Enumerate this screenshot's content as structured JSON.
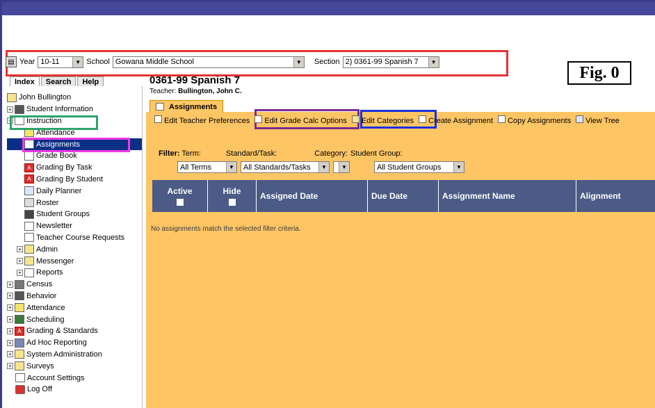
{
  "toolbar": {
    "year_label": "Year",
    "year_value": "10-11",
    "school_label": "School",
    "school_value": "Gowana Middle School",
    "section_label": "Section",
    "section_value": "2) 0361-99 Spanish 7"
  },
  "fig_label": "Fig. 0",
  "tabs": [
    "Index",
    "Search",
    "Help"
  ],
  "sidebar": {
    "items": [
      {
        "label": "John Bullington"
      },
      {
        "label": "Student Information"
      },
      {
        "label": "Instruction"
      },
      {
        "label": "Attendance"
      },
      {
        "label": "Assignments"
      },
      {
        "label": "Grade Book"
      },
      {
        "label": "Grading By Task"
      },
      {
        "label": "Grading By Student"
      },
      {
        "label": "Daily Planner"
      },
      {
        "label": "Roster"
      },
      {
        "label": "Student Groups"
      },
      {
        "label": "Newsletter"
      },
      {
        "label": "Teacher Course Requests"
      },
      {
        "label": "Admin"
      },
      {
        "label": "Messenger"
      },
      {
        "label": "Reports"
      },
      {
        "label": "Census"
      },
      {
        "label": "Behavior"
      },
      {
        "label": "Attendance"
      },
      {
        "label": "Scheduling"
      },
      {
        "label": "Grading & Standards"
      },
      {
        "label": "Ad Hoc Reporting"
      },
      {
        "label": "System Administration"
      },
      {
        "label": "Surveys"
      },
      {
        "label": "Account Settings"
      },
      {
        "label": "Log Off"
      }
    ]
  },
  "main": {
    "title": "0361-99 Spanish 7",
    "teacher_prefix": "Teacher:",
    "teacher_name": "Bullington, John C.",
    "tab_label": "Assignments",
    "actions": [
      {
        "label": "Edit Teacher Preferences"
      },
      {
        "label": "Edit Grade Calc Options"
      },
      {
        "label": "Edit Categories"
      },
      {
        "label": "Create Assignment"
      },
      {
        "label": "Copy Assignments"
      },
      {
        "label": "View Tree"
      }
    ],
    "filter": {
      "label": "Filter:",
      "term_label": "Term:",
      "standard_label": "Standard/Task:",
      "category_label": "Category:",
      "group_label": "Student Group:",
      "term_value": "All Terms",
      "standard_value": "All Standards/Tasks",
      "category_value": "",
      "group_value": "All Student Groups"
    },
    "columns": [
      "Active",
      "Hide",
      "Assigned Date",
      "Due Date",
      "Assignment Name",
      "Alignment"
    ],
    "empty_message": "No assignments match the selected filter criteria."
  }
}
